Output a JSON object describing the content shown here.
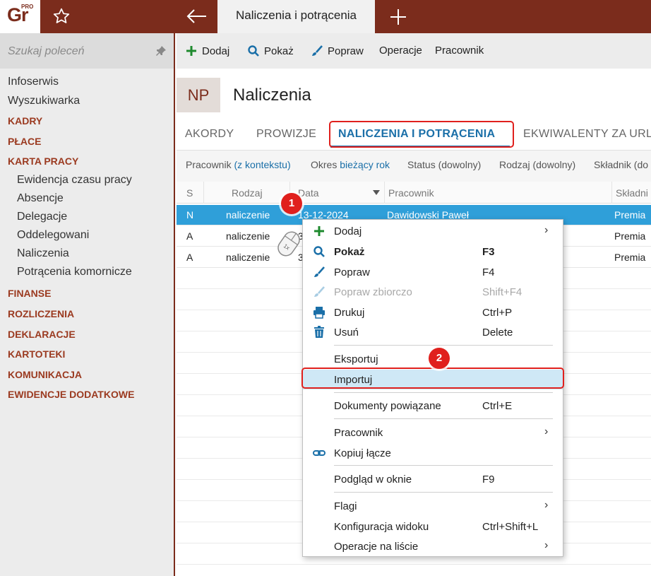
{
  "topbar": {
    "logo_text": "Gr",
    "logo_sup": "PRO",
    "tab_title": "Naliczenia i potrącenia",
    "bar_color": "#7b2c1c"
  },
  "sidebar": {
    "search_placeholder": "Szukaj poleceń",
    "items": [
      {
        "label": "Infoserwis",
        "kind": "item"
      },
      {
        "label": "Wyszukiwarka",
        "kind": "item"
      },
      {
        "label": "KADRY",
        "kind": "section"
      },
      {
        "label": "PŁACE",
        "kind": "section"
      },
      {
        "label": "KARTA PRACY",
        "kind": "section"
      },
      {
        "label": "Ewidencja czasu pracy",
        "kind": "sub"
      },
      {
        "label": "Absencje",
        "kind": "sub"
      },
      {
        "label": "Delegacje",
        "kind": "sub"
      },
      {
        "label": "Oddelegowani",
        "kind": "sub"
      },
      {
        "label": "Naliczenia",
        "kind": "sub"
      },
      {
        "label": "Potrącenia komornicze",
        "kind": "sub"
      },
      {
        "label": "FINANSE",
        "kind": "section"
      },
      {
        "label": "ROZLICZENIA",
        "kind": "section"
      },
      {
        "label": "DEKLARACJE",
        "kind": "section"
      },
      {
        "label": "KARTOTEKI",
        "kind": "section"
      },
      {
        "label": "KOMUNIKACJA",
        "kind": "section"
      },
      {
        "label": "EWIDENCJE DODATKOWE",
        "kind": "section"
      }
    ]
  },
  "toolbar": {
    "add": "Dodaj",
    "show": "Pokaż",
    "edit": "Popraw",
    "operations": "Operacje",
    "employee": "Pracownik"
  },
  "header": {
    "badge": "NP",
    "title": "Naliczenia"
  },
  "tabs": [
    "AKORDY",
    "PROWIZJE",
    "NALICZENIA I POTRĄCENIA",
    "EKWIWALENTY ZA URL"
  ],
  "filters": [
    {
      "label": "Pracownik",
      "value": "(z kontekstu)"
    },
    {
      "label": "Okres",
      "value": "bieżący rok"
    },
    {
      "label": "Status (dowolny)",
      "value": ""
    },
    {
      "label": "Rodzaj (dowolny)",
      "value": ""
    },
    {
      "label": "Składnik (do",
      "value": ""
    }
  ],
  "grid": {
    "columns": [
      "S",
      "Rodzaj",
      "Data",
      "Pracownik",
      "Składni"
    ],
    "rows": [
      {
        "s": "N",
        "rodzaj": "naliczenie",
        "data": "13-12-2024",
        "pracownik": "Dawidowski Paweł",
        "skladnik": "Premia"
      },
      {
        "s": "A",
        "rodzaj": "naliczenie",
        "data": "3",
        "pracownik": "",
        "skladnik": "Premia"
      },
      {
        "s": "A",
        "rodzaj": "naliczenie",
        "data": "3",
        "pracownik": "",
        "skladnik": "Premia"
      }
    ]
  },
  "context_menu": {
    "items": [
      {
        "label": "Dodaj",
        "shortcut": "",
        "arrow": "›",
        "icon": "plus-icon"
      },
      {
        "label": "Pokaż",
        "shortcut": "F3",
        "arrow": "",
        "icon": "search-icon"
      },
      {
        "label": "Popraw",
        "shortcut": "F4",
        "arrow": "",
        "icon": "brush-icon"
      },
      {
        "label": "Popraw zbiorczo",
        "shortcut": "Shift+F4",
        "arrow": "",
        "icon": "brush-icon"
      },
      {
        "label": "Drukuj",
        "shortcut": "Ctrl+P",
        "arrow": "",
        "icon": "printer-icon"
      },
      {
        "label": "Usuń",
        "shortcut": "Delete",
        "arrow": "",
        "icon": "trash-icon"
      },
      {
        "label": "Eksportuj",
        "shortcut": "",
        "arrow": "",
        "icon": ""
      },
      {
        "label": "Importuj",
        "shortcut": "",
        "arrow": "",
        "icon": ""
      },
      {
        "label": "Dokumenty powiązane",
        "shortcut": "Ctrl+E",
        "arrow": "",
        "icon": ""
      },
      {
        "label": "Pracownik",
        "shortcut": "",
        "arrow": "›",
        "icon": ""
      },
      {
        "label": "Kopiuj łącze",
        "shortcut": "",
        "arrow": "",
        "icon": "link-icon"
      },
      {
        "label": "Podgląd w oknie",
        "shortcut": "F9",
        "arrow": "",
        "icon": ""
      },
      {
        "label": "Flagi",
        "shortcut": "",
        "arrow": "›",
        "icon": ""
      },
      {
        "label": "Konfiguracja widoku",
        "shortcut": "Ctrl+Shift+L",
        "arrow": "",
        "icon": ""
      },
      {
        "label": "Operacje na liście",
        "shortcut": "",
        "arrow": "›",
        "icon": ""
      }
    ]
  },
  "callouts": {
    "one": "1",
    "two": "2",
    "mouse_label": "1x"
  },
  "colors": {
    "accent": "#1a6fa8",
    "brand": "#7b2c1c",
    "callout": "#e0201d",
    "selection": "#2f9fd9"
  }
}
